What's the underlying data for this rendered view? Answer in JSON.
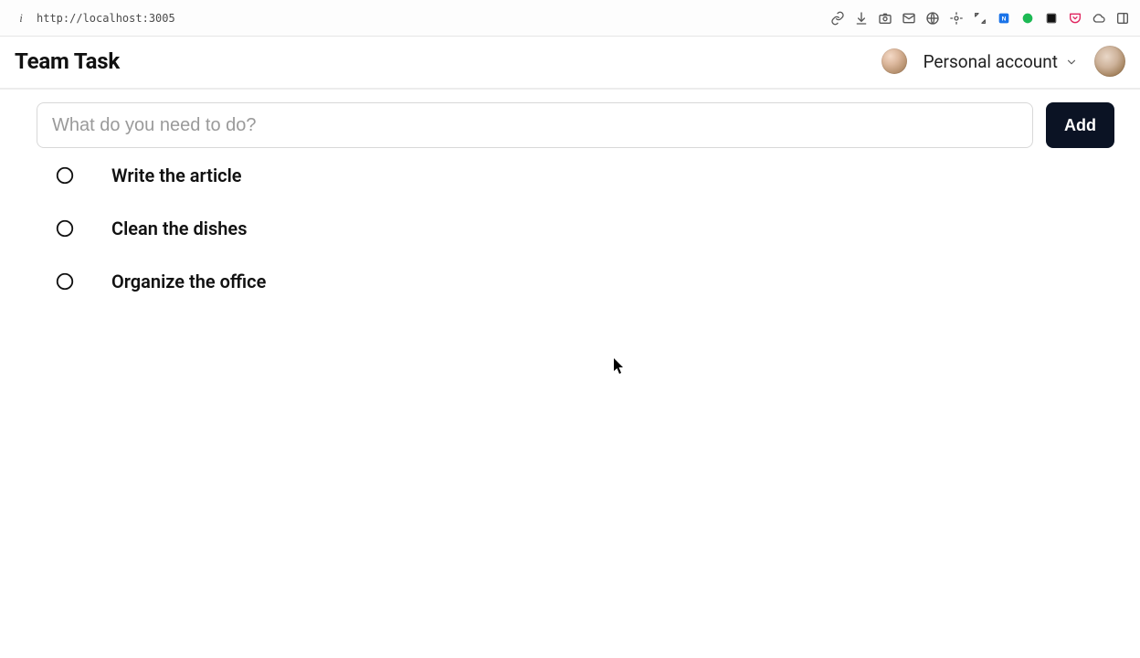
{
  "browser": {
    "url": "http://localhost:3005"
  },
  "header": {
    "app_title": "Team Task",
    "account_label": "Personal account"
  },
  "compose": {
    "placeholder": "What do you need to do?",
    "add_label": "Add"
  },
  "tasks": [
    {
      "label": "Write the article",
      "done": false
    },
    {
      "label": "Clean the dishes",
      "done": false
    },
    {
      "label": "Organize the office",
      "done": false
    }
  ]
}
